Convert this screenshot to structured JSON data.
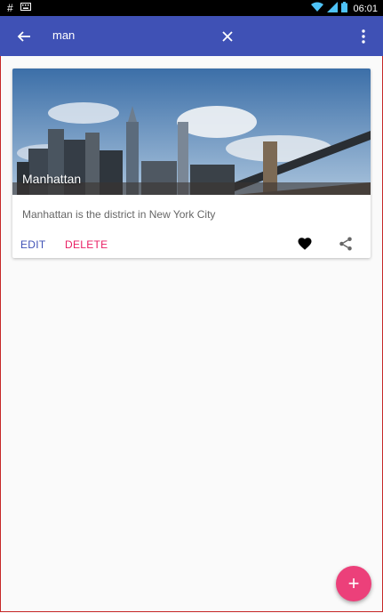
{
  "status_bar": {
    "time": "06:01",
    "icons": [
      "hash-icon",
      "keyboard-icon",
      "wifi-icon",
      "signal-icon",
      "battery-icon"
    ]
  },
  "app_bar": {
    "search_query": "man",
    "icons": [
      "back-arrow-icon",
      "clear-icon",
      "more-vert-icon"
    ]
  },
  "card": {
    "title": "Manhattan",
    "description": "Manhattan is the district in New York City",
    "edit_label": "EDIT",
    "delete_label": "DELETE",
    "icons": [
      "favorite-icon",
      "share-icon"
    ]
  },
  "fab": {
    "label": "+"
  },
  "colors": {
    "primary": "#3f51b5",
    "accent": "#e91e63",
    "fab": "#ec407a",
    "background": "#fafafa"
  }
}
